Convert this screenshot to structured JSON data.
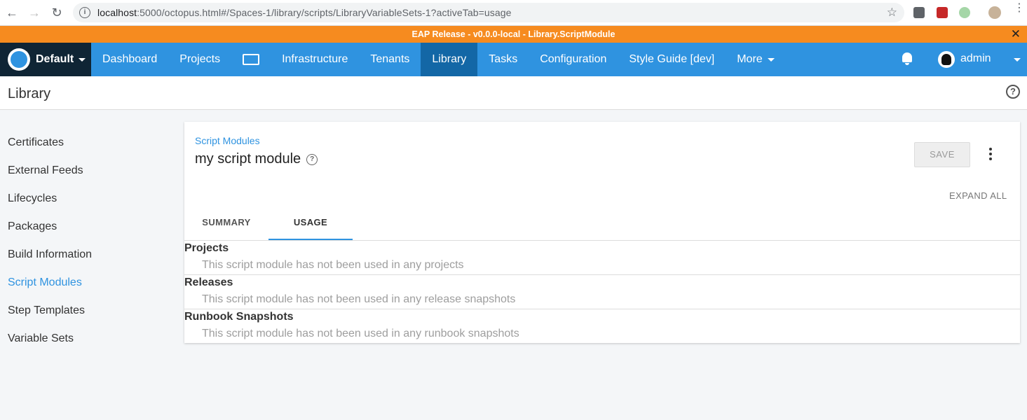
{
  "browser": {
    "url_host": "localhost",
    "url_rest": ":5000/octopus.html#/Spaces-1/library/scripts/LibraryVariableSets-1?activeTab=usage"
  },
  "banner": {
    "text": "EAP Release - v0.0.0-local - Library.ScriptModule",
    "close": "✕"
  },
  "topnav": {
    "space": "Default",
    "items": [
      {
        "label": "Dashboard"
      },
      {
        "label": "Projects"
      },
      {
        "label": ""
      },
      {
        "label": "Infrastructure"
      },
      {
        "label": "Tenants"
      },
      {
        "label": "Library"
      },
      {
        "label": "Tasks"
      },
      {
        "label": "Configuration"
      },
      {
        "label": "Style Guide [dev]"
      },
      {
        "label": "More"
      }
    ],
    "active": "Library",
    "user": "admin"
  },
  "page": {
    "title": "Library",
    "help": "?"
  },
  "sidebar": {
    "items": [
      {
        "label": "Certificates"
      },
      {
        "label": "External Feeds"
      },
      {
        "label": "Lifecycles"
      },
      {
        "label": "Packages"
      },
      {
        "label": "Build Information"
      },
      {
        "label": "Script Modules"
      },
      {
        "label": "Step Templates"
      },
      {
        "label": "Variable Sets"
      }
    ],
    "active": "Script Modules"
  },
  "card": {
    "breadcrumb": "Script Modules",
    "title": "my script module",
    "help": "?",
    "save_label": "SAVE",
    "expand_all": "EXPAND ALL",
    "tabs": [
      {
        "label": "SUMMARY"
      },
      {
        "label": "USAGE"
      }
    ],
    "active_tab": "USAGE",
    "sections": [
      {
        "title": "Projects",
        "text": "This script module has not been used in any projects"
      },
      {
        "title": "Releases",
        "text": "This script module has not been used in any release snapshots"
      },
      {
        "title": "Runbook Snapshots",
        "text": "This script module has not been used in any runbook snapshots"
      }
    ]
  },
  "colors": {
    "brand_blue": "#2f93e0",
    "active_nav": "#1367a6",
    "banner_orange": "#f68b1f",
    "space_dark": "#0f2535"
  }
}
